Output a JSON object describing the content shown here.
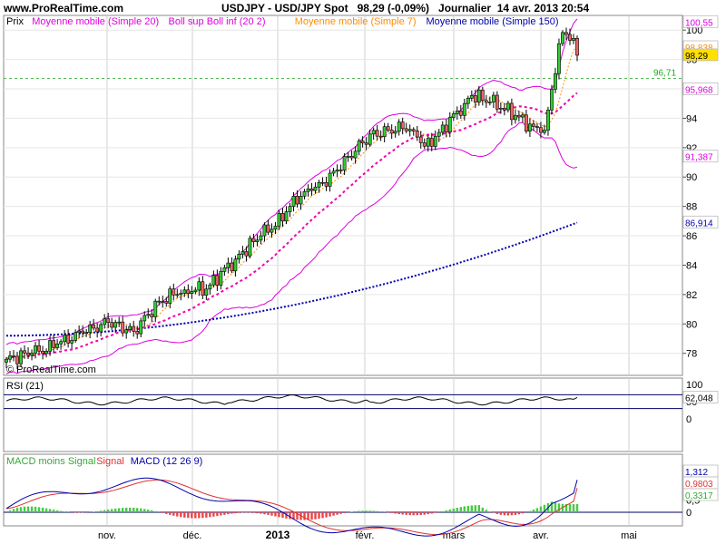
{
  "header": {
    "site": "www.ProRealTime.com",
    "symbol": "USDJPY - USD/JPY Spot",
    "price": "98,29 (-0,09%)",
    "period": "Journalier",
    "datetime": "14 avr. 2013 20:54"
  },
  "watermark": "© ProRealTime.com",
  "months": [
    "nov.",
    "déc.",
    "2013",
    "févr.",
    "mars",
    "avr.",
    "mai"
  ],
  "price_panel": {
    "legend": [
      {
        "text": "Prix",
        "color": "#000000"
      },
      {
        "text": "Moyenne mobile (Simple 20)",
        "color": "#dd00dd"
      },
      {
        "text": "Boll sup Boll inf (20 2)",
        "color": "#dd00dd"
      },
      {
        "text": "Moyenne mobile (Simple 7)",
        "color": "#ff8c00"
      },
      {
        "text": "Moyenne mobile (Simple 150)",
        "color": "#0000aa"
      }
    ],
    "ticks": [
      "100",
      "98",
      "96",
      "94",
      "92",
      "90",
      "88",
      "86",
      "84",
      "82",
      "80",
      "78"
    ],
    "level_line": "96,71",
    "tags": [
      {
        "text": "100,55",
        "color": "#dd00dd",
        "bg": "#ffffff",
        "value": 100.55
      },
      {
        "text": "98,838",
        "color": "#ff8c00",
        "bg": "#ffffff",
        "value": 98.84
      },
      {
        "text": "98,29",
        "color": "#000000",
        "bg": "#ffe000",
        "value": 98.29
      },
      {
        "text": "95,968",
        "color": "#dd00dd",
        "bg": "#ffffff",
        "value": 95.97
      },
      {
        "text": "91,387",
        "color": "#dd00dd",
        "bg": "#ffffff",
        "value": 91.39
      },
      {
        "text": "86,914",
        "color": "#0000aa",
        "bg": "#ffffff",
        "value": 86.91
      }
    ]
  },
  "rsi_panel": {
    "label": "RSI (21)",
    "ticks": [
      "100",
      "50",
      "0"
    ],
    "value": "62,048"
  },
  "macd_panel": {
    "label_parts": [
      {
        "text": "MACD moins Signal",
        "color": "#33aa33"
      },
      {
        "text": "Signal",
        "color": "#dd3333"
      },
      {
        "text": "MACD (12 26 9)",
        "color": "#0000aa"
      }
    ],
    "ticks": [
      "1,5",
      "1",
      "0,5",
      "0"
    ],
    "values": [
      {
        "text": "1,312",
        "color": "#0000aa"
      },
      {
        "text": "0,9803",
        "color": "#dd3333"
      },
      {
        "text": "0,3317",
        "color": "#33aa33"
      }
    ]
  },
  "chart_data": {
    "type": "candlestick",
    "title": "USDJPY - USD/JPY Spot",
    "price_ylim": [
      76.5,
      101
    ],
    "close_anchors": [
      [
        0,
        77.6
      ],
      [
        10,
        78.2
      ],
      [
        20,
        79.3
      ],
      [
        28,
        80.1
      ],
      [
        35,
        79.5
      ],
      [
        42,
        81.5
      ],
      [
        48,
        82.3
      ],
      [
        55,
        82.4
      ],
      [
        60,
        83.7
      ],
      [
        68,
        85.6
      ],
      [
        75,
        87.0
      ],
      [
        80,
        88.6
      ],
      [
        85,
        89.2
      ],
      [
        90,
        90.2
      ],
      [
        95,
        91.6
      ],
      [
        100,
        92.8
      ],
      [
        105,
        93.2
      ],
      [
        110,
        93.4
      ],
      [
        113,
        93.0
      ],
      [
        115,
        92.0
      ],
      [
        120,
        93.3
      ],
      [
        125,
        94.7
      ],
      [
        128,
        95.6
      ],
      [
        132,
        95.2
      ],
      [
        136,
        94.8
      ],
      [
        140,
        94.2
      ],
      [
        145,
        93.3
      ],
      [
        148,
        92.9
      ],
      [
        151,
        97.5
      ],
      [
        153,
        99.8
      ],
      [
        155,
        99.6
      ],
      [
        157,
        98.29
      ]
    ],
    "rsi": {
      "last": 62.048,
      "range": [
        0,
        100
      ]
    },
    "macd": {
      "macd_last": 1.312,
      "signal_last": 0.9803,
      "hist_last": 0.3317
    }
  }
}
